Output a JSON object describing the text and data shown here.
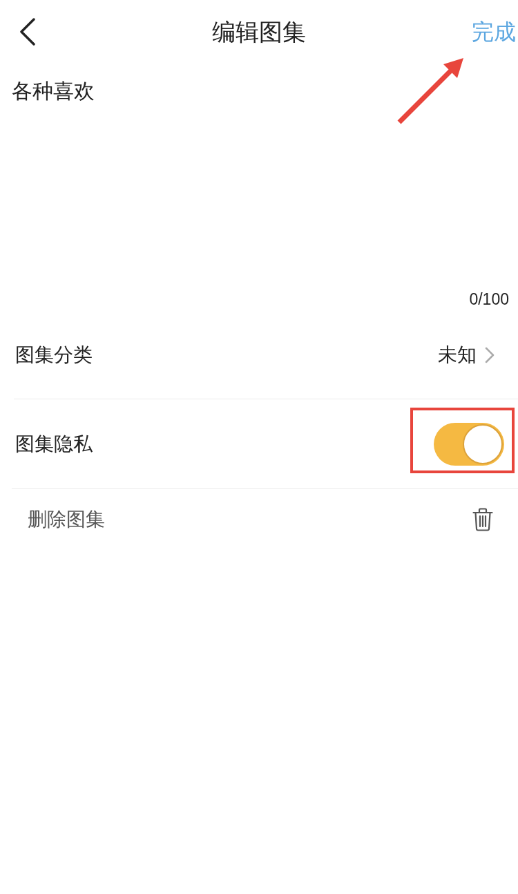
{
  "header": {
    "title": "编辑图集",
    "done": "完成",
    "arrow_annotation": true
  },
  "text_area": {
    "value": "各种喜欢",
    "counter": "0/100"
  },
  "settings": [
    {
      "kind": "select",
      "label": "图集分类",
      "value": "未知"
    },
    {
      "kind": "toggle",
      "label": "图集隐私",
      "on": true,
      "highlight_frame": true
    }
  ],
  "delete_row": {
    "label": "删除图集"
  }
}
